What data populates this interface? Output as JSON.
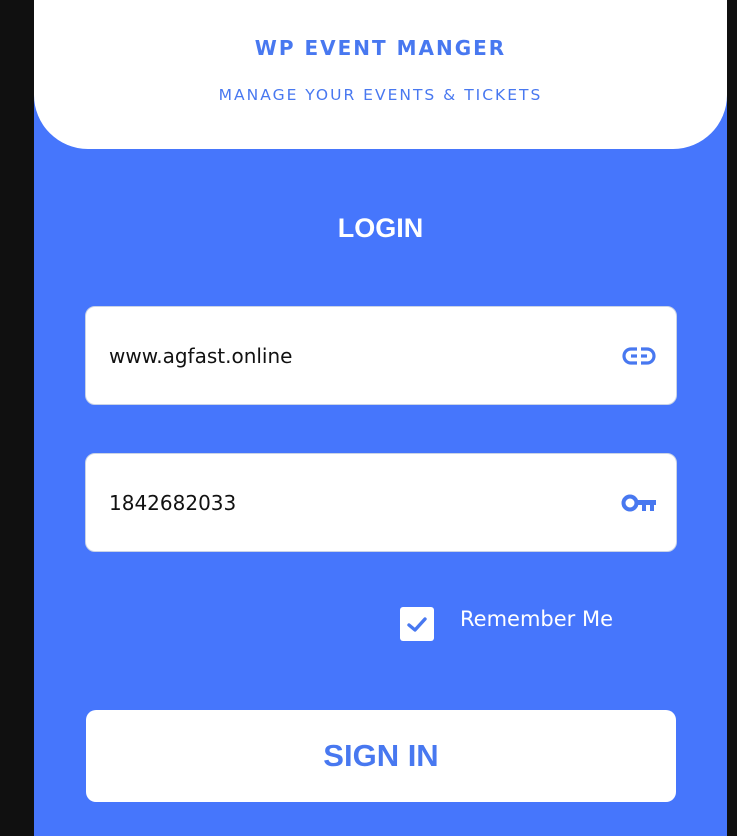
{
  "header": {
    "title": "WP EVENT MANGER",
    "subtitle": "MANAGE YOUR EVENTS & TICKETS"
  },
  "login": {
    "title": "LOGIN",
    "url_field": {
      "value": "www.agfast.online",
      "icon": "link-icon"
    },
    "password_field": {
      "value": "1842682033",
      "icon": "key-icon"
    },
    "remember_me": {
      "label": "Remember Me",
      "checked": true
    },
    "signin_label": "SIGN IN"
  },
  "colors": {
    "background": "#4676fc",
    "accent": "#4878f0",
    "surface": "#ffffff",
    "frame": "#101010"
  }
}
